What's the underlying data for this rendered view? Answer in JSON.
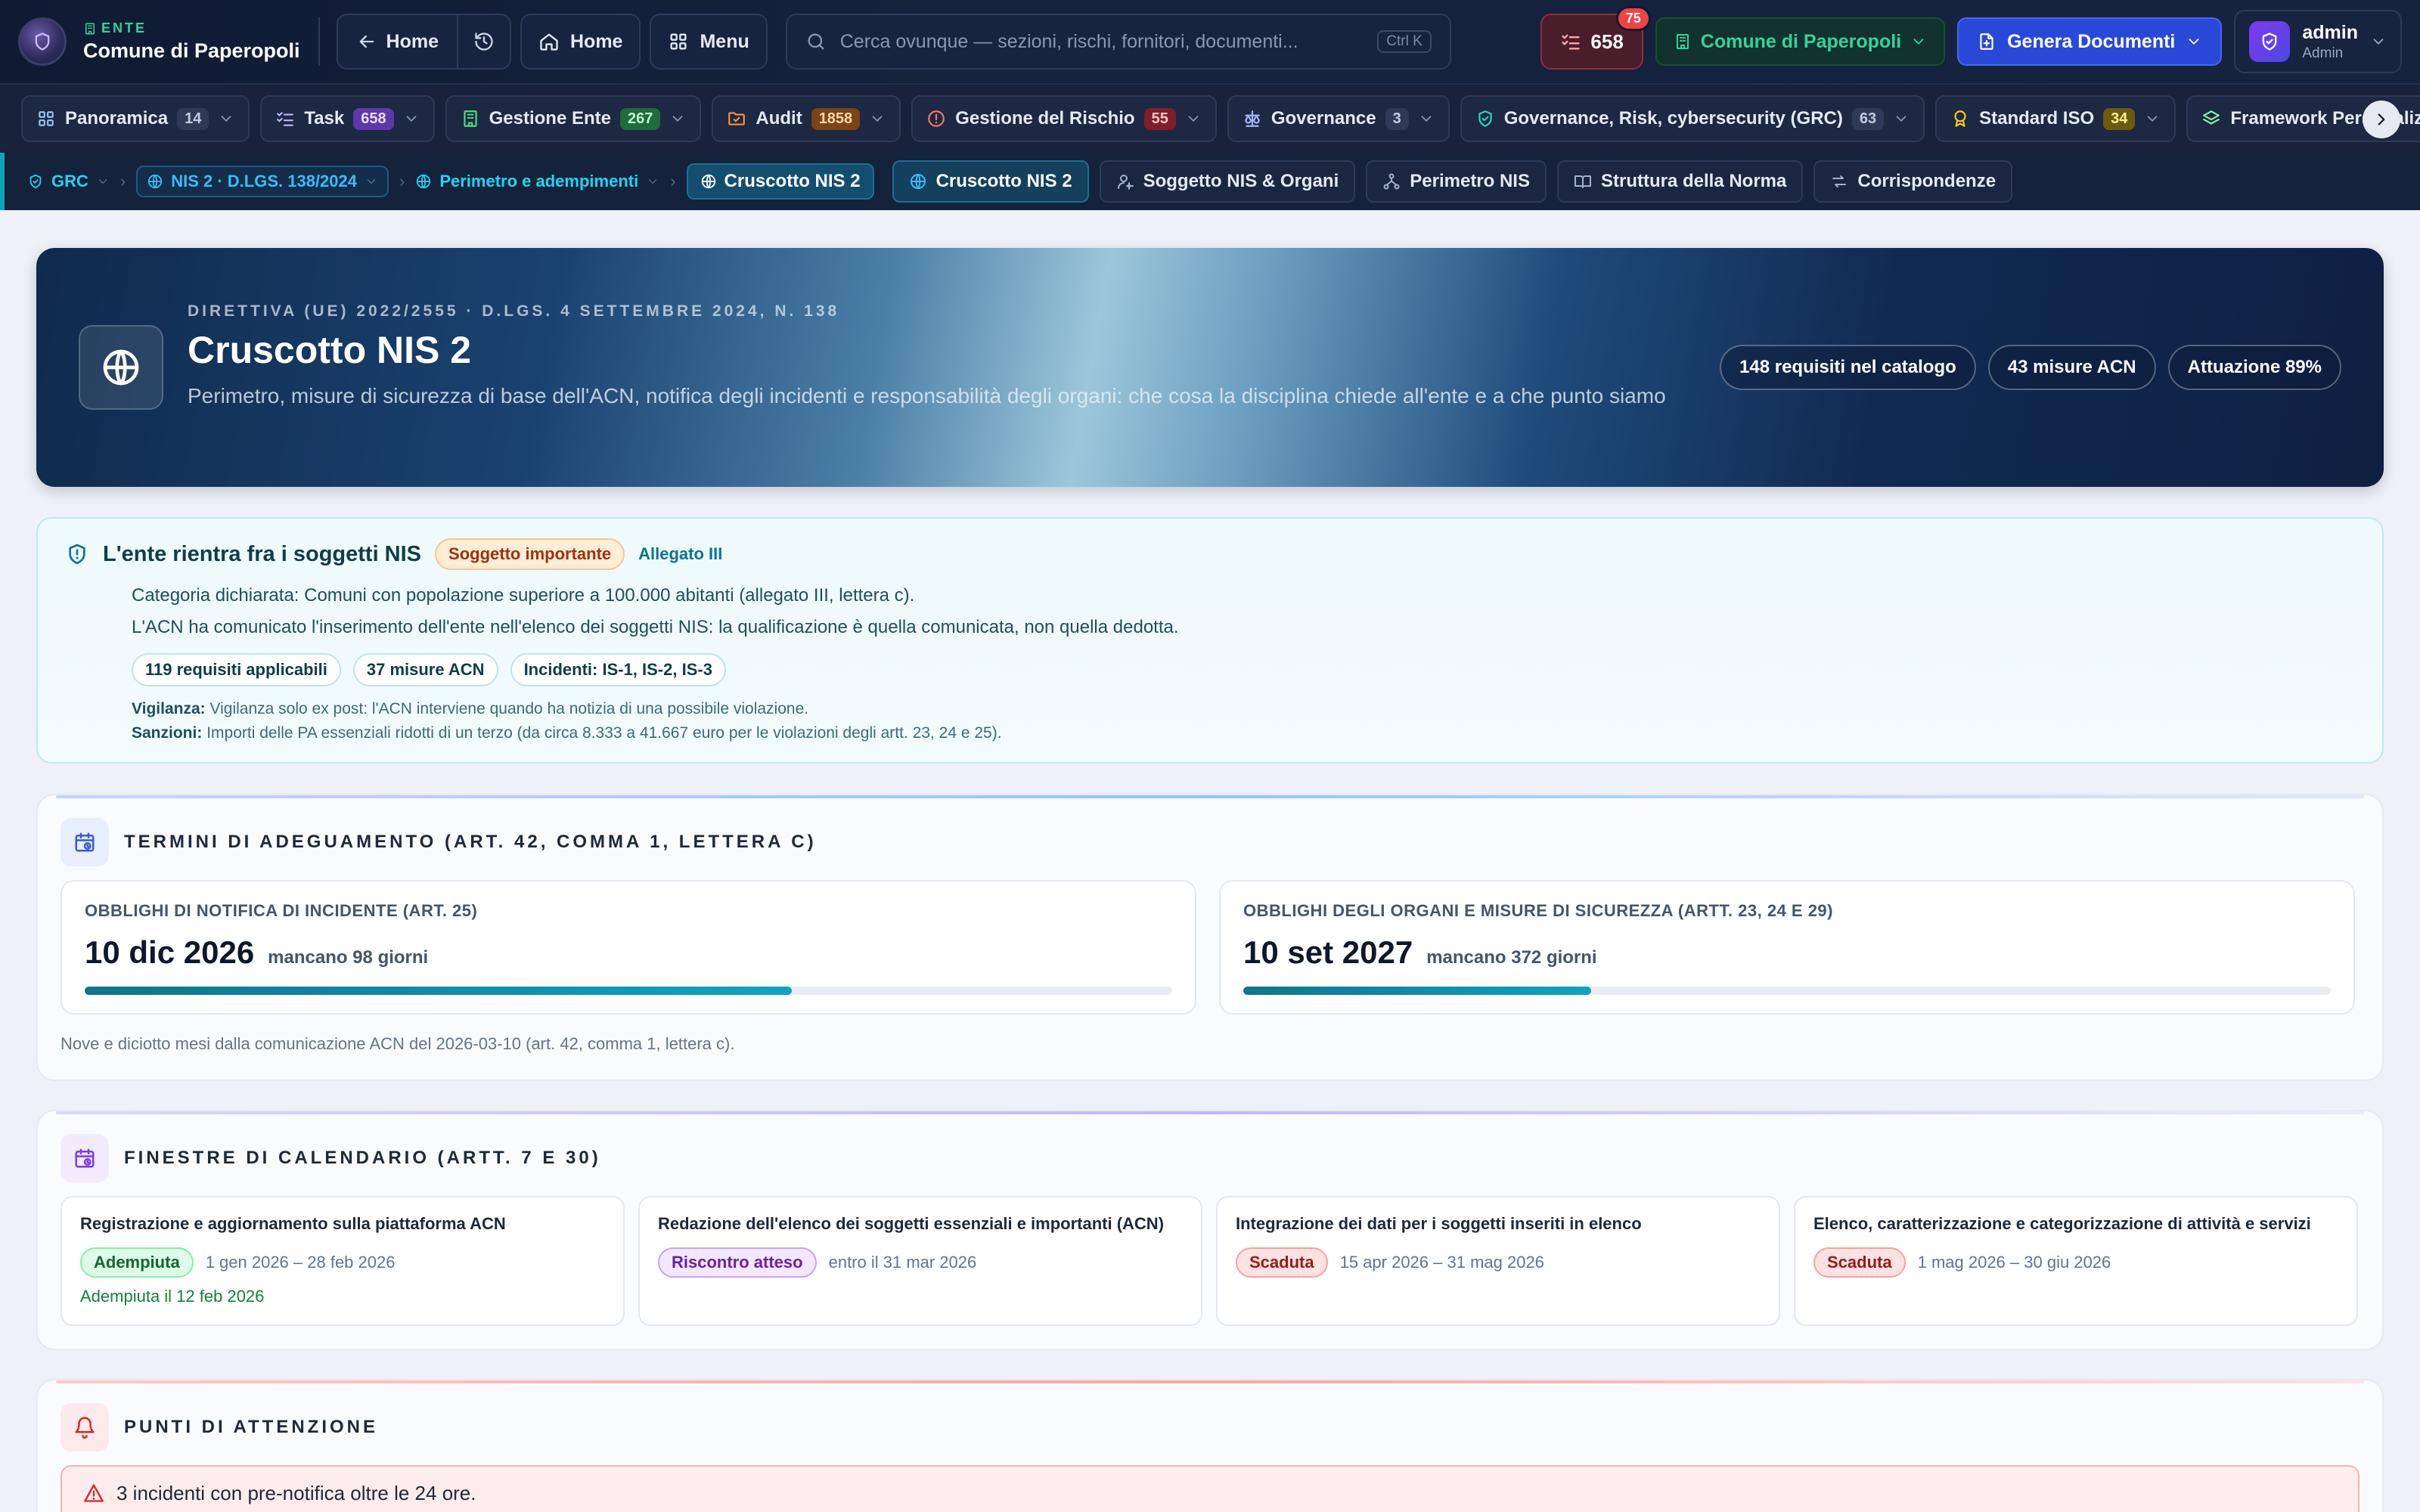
{
  "topbar": {
    "entity_kicker": "ENTE",
    "entity_name": "Comune di Paperopoli",
    "back_label": "Home",
    "home_label": "Home",
    "menu_label": "Menu",
    "search_placeholder": "Cerca ovunque — sezioni, rischi, fornitori, documenti...",
    "search_shortcut": "Ctrl K",
    "tasks_count": "658",
    "tasks_notification": "75",
    "ente_selector": "Comune di Paperopoli",
    "generate_docs": "Genera Documenti",
    "user_name": "admin",
    "user_role": "Admin"
  },
  "modules": [
    {
      "label": "Panoramica",
      "count": "14",
      "icon": "grid-icon",
      "color": "#93c5fd",
      "count_bg": "#2e3b58",
      "count_fg": "#c3cbe0"
    },
    {
      "label": "Task",
      "count": "658",
      "icon": "checklist-icon",
      "color": "#c4b5fd",
      "count_bg": "#5b3aa8",
      "count_fg": "#e9ddff"
    },
    {
      "label": "Gestione Ente",
      "count": "267",
      "icon": "building-icon",
      "color": "#4ade80",
      "count_bg": "#1f6b3a",
      "count_fg": "#bbf7d0"
    },
    {
      "label": "Audit",
      "count": "1858",
      "icon": "folder-icon",
      "color": "#fb923c",
      "count_bg": "#7a4416",
      "count_fg": "#fed7aa"
    },
    {
      "label": "Gestione del Rischio",
      "count": "55",
      "icon": "alert-circle-icon",
      "color": "#f87171",
      "count_bg": "#7f1d2d",
      "count_fg": "#fecaca"
    },
    {
      "label": "Governance",
      "count": "3",
      "icon": "scale-icon",
      "color": "#a5b4fc",
      "count_bg": "#2e3b58",
      "count_fg": "#c3cbe0"
    },
    {
      "label": "Governance, Risk, cybersecurity (GRC)",
      "count": "63",
      "icon": "shield-check-icon",
      "color": "#2dd4bf",
      "count_bg": "#2e3b58",
      "count_fg": "#c3cbe0"
    },
    {
      "label": "Standard ISO",
      "count": "34",
      "icon": "award-icon",
      "color": "#facc15",
      "count_bg": "#6b5a12",
      "count_fg": "#fef08a"
    },
    {
      "label": "Framework Personalizzati",
      "count": "",
      "icon": "layers-icon",
      "color": "#86efac",
      "count_bg": "#2e3b58",
      "count_fg": "#c3cbe0"
    }
  ],
  "subnav": {
    "crumb_grc": "GRC",
    "crumb_nis": "NIS 2 · D.LGS. 138/2024",
    "crumb_perimeter": "Perimetro e adempimenti",
    "crumb_current": "Cruscotto NIS 2",
    "tabs": [
      "Cruscotto NIS 2",
      "Soggetto NIS & Organi",
      "Perimetro NIS",
      "Struttura della Norma",
      "Corrispondenze"
    ]
  },
  "hero": {
    "kicker": "DIRETTIVA (UE) 2022/2555 · D.LGS. 4 SETTEMBRE 2024, N. 138",
    "title": "Cruscotto NIS 2",
    "subtitle": "Perimetro, misure di sicurezza di base dell'ACN, notifica degli incidenti e responsabilità degli organi: che cosa la disciplina chiede all'ente e a che punto siamo",
    "chips": [
      "148 requisiti nel catalogo",
      "43 misure ACN",
      "Attuazione 89%"
    ]
  },
  "nis": {
    "title": "L'ente rientra fra i soggetti NIS",
    "badge": "Soggetto importante",
    "annex": "Allegato III",
    "category": "Categoria dichiarata: Comuni con popolazione superiore a 100.000 abitanti (allegato III, lettera c).",
    "communication": "L'ACN ha comunicato l'inserimento dell'ente nell'elenco dei soggetti NIS: la qualificazione è quella comunicata, non quella dedotta.",
    "chips": [
      "119 requisiti applicabili",
      "37 misure ACN",
      "Incidenti: IS-1, IS-2, IS-3"
    ],
    "vigilance_label": "Vigilanza:",
    "vigilance_text": "Vigilanza solo ex post: l'ACN interviene quando ha notizia di una possibile violazione.",
    "sanctions_label": "Sanzioni:",
    "sanctions_text": "Importi delle PA essenziali ridotti di un terzo (da circa 8.333 a 41.667 euro per le violazioni degli artt. 23, 24 e 25)."
  },
  "terms": {
    "title": "TERMINI DI ADEGUAMENTO (ART. 42, COMMA 1, LETTERA C)",
    "cards": [
      {
        "label": "OBBLIGHI DI NOTIFICA DI INCIDENTE (ART. 25)",
        "date": "10 dic 2026",
        "remaining": "mancano 98 giorni",
        "progress": 0.65
      },
      {
        "label": "OBBLIGHI DEGLI ORGANI E MISURE DI SICUREZZA (ARTT. 23, 24 E 29)",
        "date": "10 set 2027",
        "remaining": "mancano 372 giorni",
        "progress": 0.32
      }
    ],
    "note": "Nove e diciotto mesi dalla comunicazione ACN del 2026-03-10 (art. 42, comma 1, lettera c)."
  },
  "calendar": {
    "title": "FINESTRE DI CALENDARIO (ARTT. 7 E 30)",
    "windows": [
      {
        "title": "Registrazione e aggiornamento sulla piattaforma ACN",
        "status": "Adempiuta",
        "status_style": "green",
        "dates": "1 gen 2026 – 28 feb 2026",
        "note": "Adempiuta il 12 feb 2026"
      },
      {
        "title": "Redazione dell'elenco dei soggetti essenziali e importanti (ACN)",
        "status": "Riscontro atteso",
        "status_style": "purple",
        "dates": "entro il 31 mar 2026",
        "note": ""
      },
      {
        "title": "Integrazione dei dati per i soggetti inseriti in elenco",
        "status": "Scaduta",
        "status_style": "red",
        "dates": "15 apr 2026 – 31 mag 2026",
        "note": ""
      },
      {
        "title": "Elenco, caratterizzazione e categorizzazione di attività e servizi",
        "status": "Scaduta",
        "status_style": "red",
        "dates": "1 mag 2026 – 30 giu 2026",
        "note": ""
      }
    ]
  },
  "attention": {
    "title": "PUNTI DI ATTENZIONE",
    "alert": "3 incidenti con pre-notifica oltre le 24 ore."
  },
  "colors": {
    "accent_teal": "#0e7490",
    "primary_blue": "#2a48d8",
    "danger": "#dc2626",
    "success": "#15803d"
  }
}
